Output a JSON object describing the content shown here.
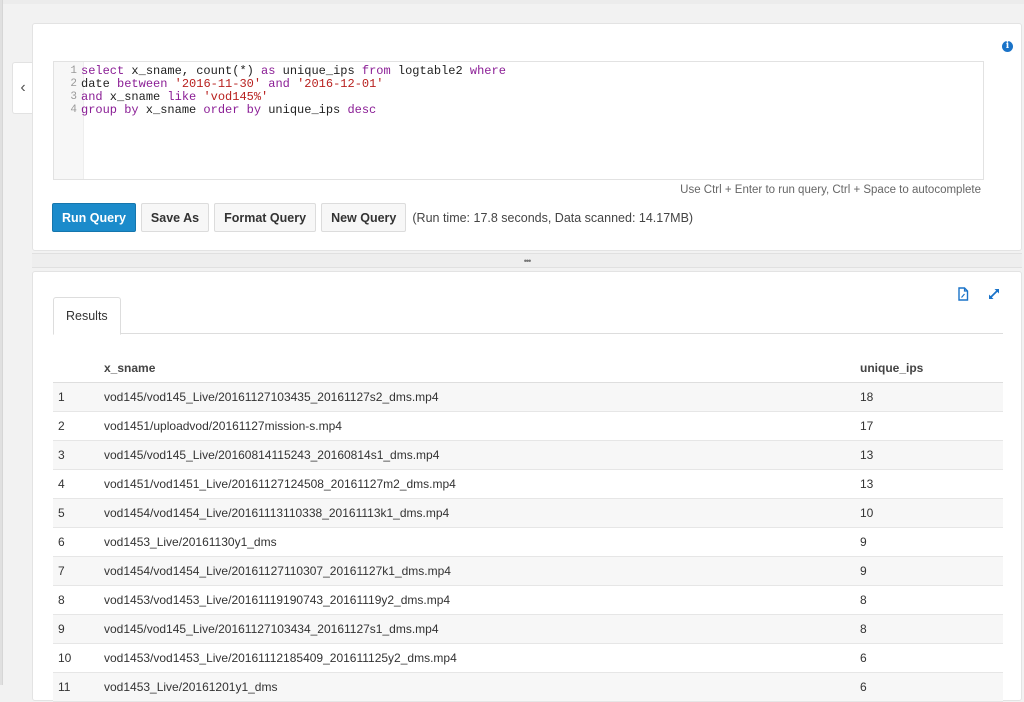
{
  "nav": {
    "back_icon": "chevron-left-icon",
    "back_glyph": "‹"
  },
  "query_panel": {
    "info_icon": "info-icon",
    "info_glyph": "i",
    "editor": {
      "lines": [
        {
          "number": "1",
          "tokens": [
            {
              "t": "kw",
              "v": "select"
            },
            {
              "t": "id",
              "v": " x_sname, count(*) "
            },
            {
              "t": "kw",
              "v": "as"
            },
            {
              "t": "id",
              "v": " unique_ips "
            },
            {
              "t": "kw",
              "v": "from"
            },
            {
              "t": "id",
              "v": " logtable2 "
            },
            {
              "t": "kw",
              "v": "where"
            }
          ]
        },
        {
          "number": "2",
          "tokens": [
            {
              "t": "id",
              "v": "date "
            },
            {
              "t": "kw",
              "v": "between"
            },
            {
              "t": "id",
              "v": " "
            },
            {
              "t": "str",
              "v": "'2016-11-30'"
            },
            {
              "t": "id",
              "v": " "
            },
            {
              "t": "kw",
              "v": "and"
            },
            {
              "t": "id",
              "v": " "
            },
            {
              "t": "str",
              "v": "'2016-12-01'"
            }
          ]
        },
        {
          "number": "3",
          "tokens": [
            {
              "t": "kw",
              "v": "and"
            },
            {
              "t": "id",
              "v": " x_sname "
            },
            {
              "t": "kw",
              "v": "like"
            },
            {
              "t": "id",
              "v": " "
            },
            {
              "t": "str",
              "v": "'vod145%'"
            }
          ]
        },
        {
          "number": "4",
          "tokens": [
            {
              "t": "kw",
              "v": "group by"
            },
            {
              "t": "id",
              "v": " x_sname "
            },
            {
              "t": "kw",
              "v": "order by"
            },
            {
              "t": "id",
              "v": " unique_ips "
            },
            {
              "t": "kw",
              "v": "desc"
            }
          ]
        }
      ]
    },
    "hint": "Use Ctrl + Enter to run query, Ctrl + Space to autocomplete",
    "buttons": {
      "run": "Run Query",
      "save_as": "Save As",
      "format": "Format Query",
      "new": "New Query"
    },
    "run_info": "(Run time: 17.8 seconds, Data scanned: 14.17MB)"
  },
  "divider": {
    "glyph": "•••"
  },
  "results_panel": {
    "icons": [
      "download-csv-icon",
      "expand-icon"
    ],
    "tabs": [
      {
        "label": "Results"
      }
    ],
    "columns": [
      "",
      "x_sname",
      "unique_ips"
    ],
    "rows": [
      {
        "idx": "1",
        "x_sname": "vod145/vod145_Live/20161127103435_20161127s2_dms.mp4",
        "unique_ips": "18"
      },
      {
        "idx": "2",
        "x_sname": "vod1451/uploadvod/20161127mission-s.mp4",
        "unique_ips": "17"
      },
      {
        "idx": "3",
        "x_sname": "vod145/vod145_Live/20160814115243_20160814s1_dms.mp4",
        "unique_ips": "13"
      },
      {
        "idx": "4",
        "x_sname": "vod1451/vod1451_Live/20161127124508_20161127m2_dms.mp4",
        "unique_ips": "13"
      },
      {
        "idx": "5",
        "x_sname": "vod1454/vod1454_Live/20161113110338_20161113k1_dms.mp4",
        "unique_ips": "10"
      },
      {
        "idx": "6",
        "x_sname": "vod1453_Live/20161130y1_dms",
        "unique_ips": "9"
      },
      {
        "idx": "7",
        "x_sname": "vod1454/vod1454_Live/20161127110307_20161127k1_dms.mp4",
        "unique_ips": "9"
      },
      {
        "idx": "8",
        "x_sname": "vod1453/vod1453_Live/20161119190743_20161119y2_dms.mp4",
        "unique_ips": "8"
      },
      {
        "idx": "9",
        "x_sname": "vod145/vod145_Live/20161127103434_20161127s1_dms.mp4",
        "unique_ips": "8"
      },
      {
        "idx": "10",
        "x_sname": "vod1453/vod1453_Live/20161112185409_201611125y2_dms.mp4",
        "unique_ips": "6"
      },
      {
        "idx": "11",
        "x_sname": "vod1453_Live/20161201y1_dms",
        "unique_ips": "6"
      }
    ]
  },
  "colors": {
    "primary_button": "#1b8bcb",
    "icon_blue": "#1a73c8",
    "sql_keyword": "#8a1d95",
    "sql_string": "#b8211f"
  }
}
